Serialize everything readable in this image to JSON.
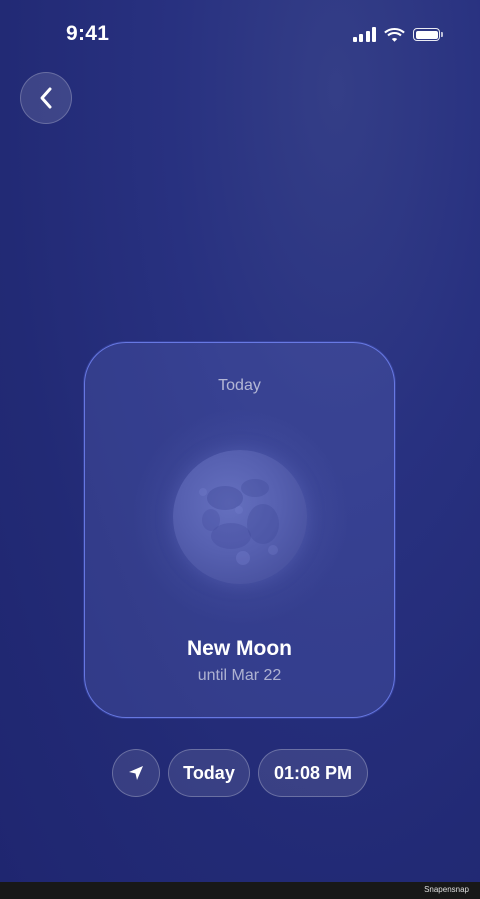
{
  "status_bar": {
    "time": "9:41",
    "icons": [
      "cellular-signal-icon",
      "wifi-icon",
      "battery-icon"
    ]
  },
  "navigation": {
    "back_icon": "chevron-left-icon"
  },
  "moon_card": {
    "day_label": "Today",
    "phase_name": "New Moon",
    "until_text": "until Mar 22",
    "moon_icon": "moon-image"
  },
  "controls": {
    "location_icon": "location-arrow-icon",
    "date_label": "Today",
    "time_label": "01:08 PM"
  },
  "footer": {
    "watermark": "Snapensnap"
  },
  "colors": {
    "background": "#232b77",
    "card_border": "#7a8cff",
    "moon": "#5a64b3"
  }
}
